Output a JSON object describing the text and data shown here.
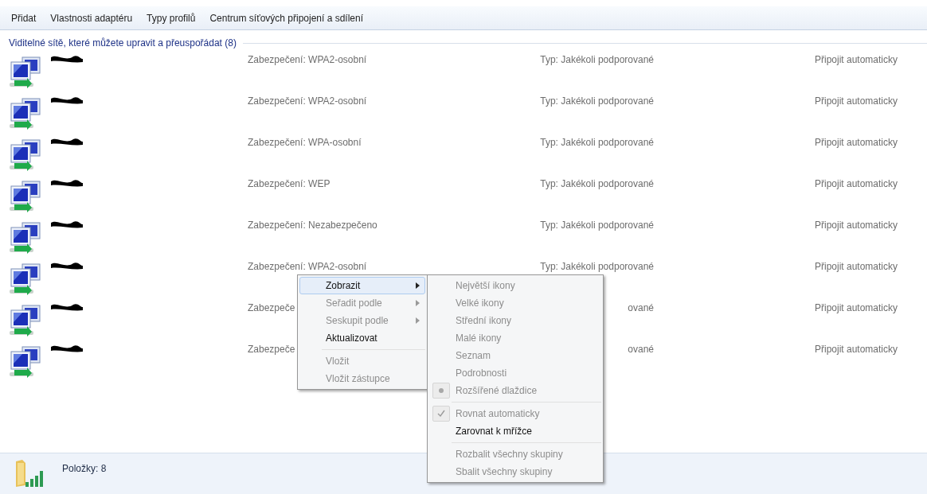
{
  "toolbar": [
    "Přidat",
    "Vlastnosti adaptéru",
    "Typy profilů",
    "Centrum síťových připojení a sdílení"
  ],
  "group": {
    "title": "Viditelné sítě, které můžete upravit a přeuspořádat (8)"
  },
  "networks": [
    {
      "security": "Zabezpečení: WPA2-osobní",
      "type": "Typ: Jakékoli podporované",
      "mode": "Připojit automaticky"
    },
    {
      "security": "Zabezpečení: WPA2-osobní",
      "type": "Typ: Jakékoli podporované",
      "mode": "Připojit automaticky"
    },
    {
      "security": "Zabezpečení: WPA-osobní",
      "type": "Typ: Jakékoli podporované",
      "mode": "Připojit automaticky"
    },
    {
      "security": "Zabezpečení: WEP",
      "type": "Typ: Jakékoli podporované",
      "mode": "Připojit automaticky"
    },
    {
      "security": "Zabezpečení: Nezabezpečeno",
      "type": "Typ: Jakékoli podporované",
      "mode": "Připojit automaticky"
    },
    {
      "security": "Zabezpečení: WPA2-osobní",
      "type": "Typ: Jakékoli podporované",
      "mode": "Připojit automaticky"
    },
    {
      "security": "Zabezpeče",
      "type": "ované",
      "mode": "Připojit automaticky"
    },
    {
      "security": "Zabezpeče",
      "type": "ované",
      "mode": "Připojit automaticky"
    }
  ],
  "context_menu": [
    {
      "kind": "item",
      "label": "Zobrazit",
      "submenu": true,
      "disabled": false,
      "selected": true
    },
    {
      "kind": "item",
      "label": "Seřadit podle",
      "submenu": true,
      "disabled": true,
      "selected": false
    },
    {
      "kind": "item",
      "label": "Seskupit podle",
      "submenu": true,
      "disabled": true,
      "selected": false
    },
    {
      "kind": "item",
      "label": "Aktualizovat",
      "submenu": false,
      "disabled": false,
      "selected": false
    },
    {
      "kind": "separator"
    },
    {
      "kind": "item",
      "label": "Vložit",
      "submenu": false,
      "disabled": true,
      "selected": false
    },
    {
      "kind": "item",
      "label": "Vložit zástupce",
      "submenu": false,
      "disabled": true,
      "selected": false
    }
  ],
  "submenu": [
    {
      "kind": "radio",
      "label": "Největší ikony",
      "disabled": true,
      "checked": false
    },
    {
      "kind": "radio",
      "label": "Velké ikony",
      "disabled": true,
      "checked": false
    },
    {
      "kind": "radio",
      "label": "Střední ikony",
      "disabled": true,
      "checked": false
    },
    {
      "kind": "radio",
      "label": "Malé ikony",
      "disabled": true,
      "checked": false
    },
    {
      "kind": "radio",
      "label": "Seznam",
      "disabled": true,
      "checked": false
    },
    {
      "kind": "radio",
      "label": "Podrobnosti",
      "disabled": true,
      "checked": false
    },
    {
      "kind": "radio",
      "label": "Rozšířené dlaždice",
      "disabled": true,
      "checked": true
    },
    {
      "kind": "separator"
    },
    {
      "kind": "check",
      "label": "Rovnat automaticky",
      "disabled": true,
      "checked": true
    },
    {
      "kind": "check",
      "label": "Zarovnat k mřížce",
      "disabled": false,
      "checked": false
    },
    {
      "kind": "separator"
    },
    {
      "kind": "item",
      "label": "Rozbalit všechny skupiny",
      "disabled": true
    },
    {
      "kind": "item",
      "label": "Sbalit všechny skupiny",
      "disabled": true
    }
  ],
  "status_bar": {
    "items": "Položky: 8"
  }
}
